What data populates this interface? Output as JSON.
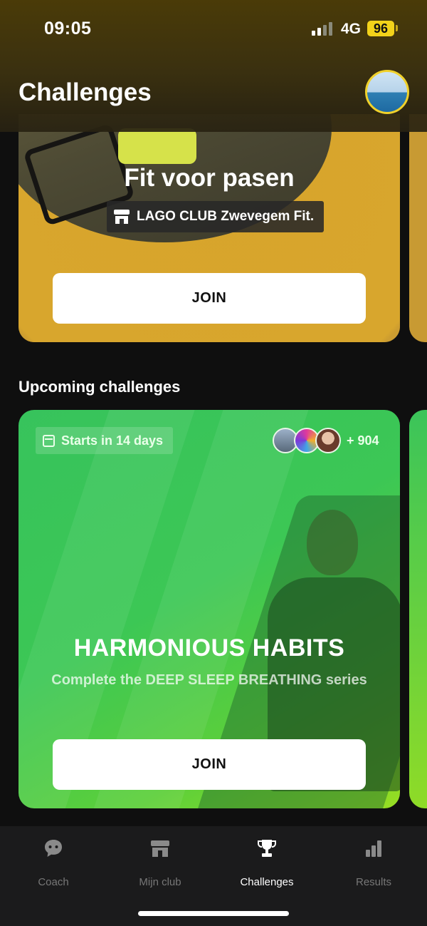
{
  "status_bar": {
    "time": "09:05",
    "network": "4G",
    "battery": "96"
  },
  "header": {
    "title": "Challenges"
  },
  "active_challenge": {
    "title": "Fit voor pasen",
    "club": "LAGO CLUB Zwevegem Fit.",
    "join_label": "JOIN"
  },
  "upcoming": {
    "section_title": "Upcoming challenges",
    "card": {
      "starts_label": "Starts in 14 days",
      "participant_count": "+ 904",
      "title": "HARMONIOUS HABITS",
      "subtitle": "Complete the DEEP SLEEP BREATHING series",
      "join_label": "JOIN"
    }
  },
  "tabs": [
    {
      "label": "Coach",
      "icon": "chat-bubble-icon"
    },
    {
      "label": "Mijn club",
      "icon": "store-icon"
    },
    {
      "label": "Challenges",
      "icon": "trophy-icon",
      "active": true
    },
    {
      "label": "Results",
      "icon": "bar-chart-icon"
    }
  ],
  "colors": {
    "accent_yellow": "#f0d12b",
    "card_green": "#3cc755",
    "tab_active": "#ffffff",
    "tab_inactive": "#777777"
  }
}
